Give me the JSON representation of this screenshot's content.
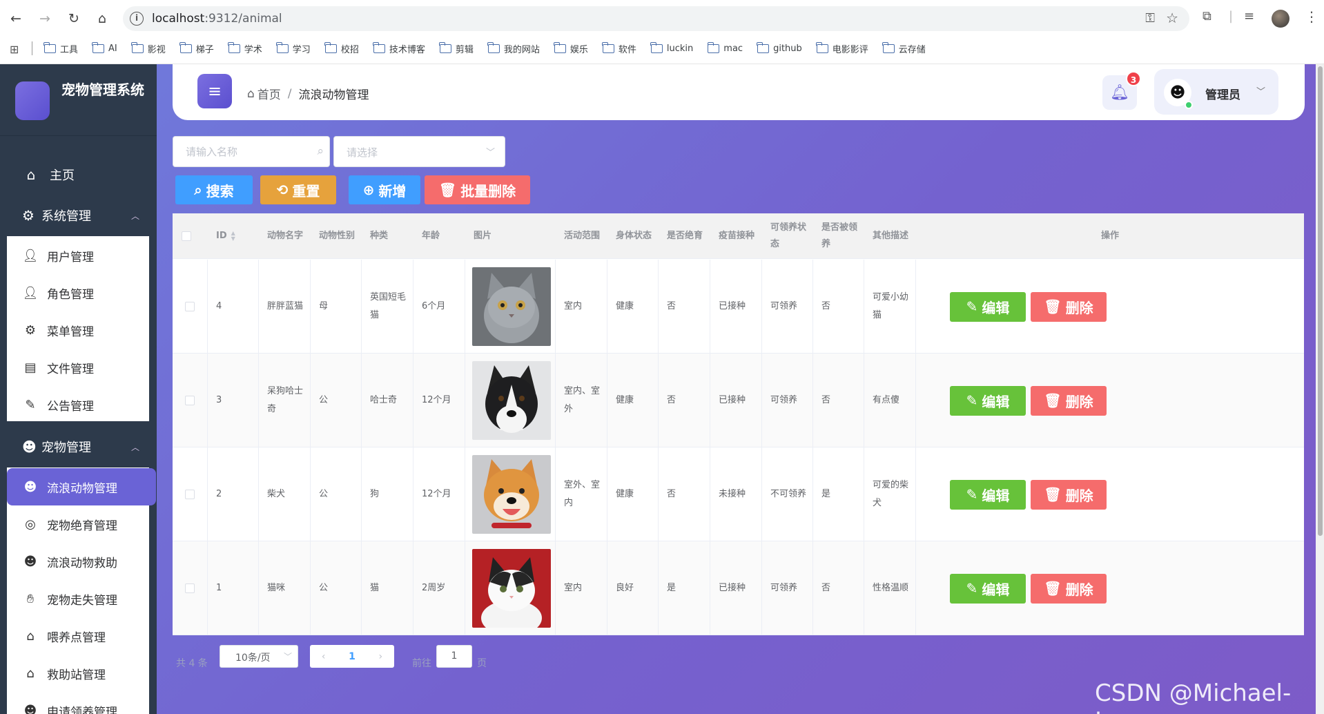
{
  "browser": {
    "url_host": "localhost",
    "url_rest": ":9312/animal",
    "bookmarks": [
      "工具",
      "AI",
      "影视",
      "梯子",
      "学术",
      "学习",
      "校招",
      "技术博客",
      "剪辑",
      "我的网站",
      "娱乐",
      "软件",
      "luckin",
      "mac",
      "github",
      "电影影评",
      "云存储"
    ]
  },
  "sidebar": {
    "title": "宠物管理系统",
    "home": "主页",
    "system_group": "系统管理",
    "system_items": [
      "用户管理",
      "角色管理",
      "菜单管理",
      "文件管理",
      "公告管理"
    ],
    "pet_group": "宠物管理",
    "pet_items": [
      "流浪动物管理",
      "宠物绝育管理",
      "流浪动物救助",
      "宠物走失管理",
      "喂养点管理",
      "救助站管理",
      "申请领养管理"
    ]
  },
  "header": {
    "breadcrumb_home": "首页",
    "breadcrumb_current": "流浪动物管理",
    "notification_count": "3",
    "user_name": "管理员"
  },
  "filters": {
    "name_placeholder": "请输入名称",
    "select_placeholder": "请选择"
  },
  "toolbar": {
    "search": "搜索",
    "reset": "重置",
    "add": "新增",
    "batch_delete": "批量删除"
  },
  "table": {
    "columns": [
      "ID",
      "动物名字",
      "动物性别",
      "种类",
      "年龄",
      "图片",
      "活动范围",
      "身体状态",
      "是否绝育",
      "疫苗接种",
      "可领养状态",
      "是否被领养",
      "其他描述",
      "操作"
    ],
    "rows": [
      {
        "id": "4",
        "name": "胖胖蓝猫",
        "sex": "母",
        "kind": "英国短毛猫",
        "age": "6个月",
        "range": "室内",
        "health": "健康",
        "neutered": "否",
        "vaccine": "已接种",
        "adoptable": "可领养",
        "adopted": "否",
        "desc": "可爱小幼猫"
      },
      {
        "id": "3",
        "name": "呆狗哈士奇",
        "sex": "公",
        "kind": "哈士奇",
        "age": "12个月",
        "range": "室内、室外",
        "health": "健康",
        "neutered": "否",
        "vaccine": "已接种",
        "adoptable": "可领养",
        "adopted": "否",
        "desc": "有点傻"
      },
      {
        "id": "2",
        "name": "柴犬",
        "sex": "公",
        "kind": "狗",
        "age": "12个月",
        "range": "室外、室内",
        "health": "健康",
        "neutered": "否",
        "vaccine": "未接种",
        "adoptable": "不可领养",
        "adopted": "是",
        "desc": "可爱的柴犬"
      },
      {
        "id": "1",
        "name": "猫咪",
        "sex": "公",
        "kind": "猫",
        "age": "2周岁",
        "range": "室内",
        "health": "良好",
        "neutered": "是",
        "vaccine": "已接种",
        "adoptable": "可领养",
        "adopted": "否",
        "desc": "性格温顺"
      }
    ],
    "edit_label": "编辑",
    "delete_label": "删除"
  },
  "pagination": {
    "total": "共 4 条",
    "page_size": "10条/页",
    "current_page": "1",
    "goto_label": "前往",
    "goto_value": "1",
    "page_suffix": "页"
  },
  "watermark": "CSDN @Michael-Jay"
}
